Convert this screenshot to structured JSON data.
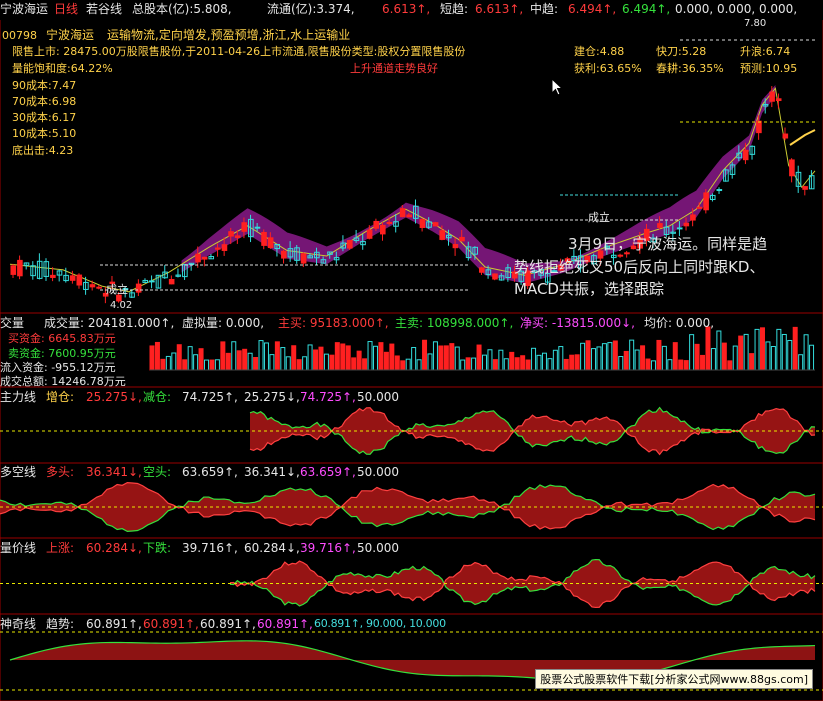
{
  "header": {
    "stock_name": "宁波海运",
    "period": "日线",
    "range": "若谷线",
    "total_equity_label": "总股本(亿):5.808,",
    "float_label": "流通(亿):3.374,",
    "float_val": "6.613↑,",
    "short_label": "短趋:",
    "short_val": "6.613↑,",
    "mid_label": "中趋:",
    "mid_val": "6.494↑,",
    "mid_val2": "6.494↑,",
    "zeros": "0.000, 0.000, 0.000,"
  },
  "info": {
    "code_line_code": "00798",
    "code_line_name": "宁波海运",
    "code_line_tags": "运输物流,定向增发,预盈预增,浙江,水上运输业",
    "restricted_line": "限售上市: 28475.00万股限售股份,于2011-04-26上市流通,限售股份类型:股权分置限售股份",
    "uptrend_note": "上升通道走势良好",
    "saturation": "量能饱和度:64.22%",
    "cost90": "90成本:7.47",
    "cost70": "70成本:6.98",
    "cost30": "30成本:6.17",
    "cost10": "10成本:5.10",
    "bottom": "底出击:4.23"
  },
  "right_panel": {
    "build": "建仓:4.88",
    "profit": "获利:63.65%",
    "fast": "快刀:5.28",
    "spring": "春耕:36.35%",
    "rise": "升浪:6.74",
    "forecast": "预测:10.95",
    "high_mark": "7.80"
  },
  "annotations": {
    "main_note": "3月9日，宁波海运。同样是趋势线拒绝死叉50后反向上同时跟KD、MACD共振，选择跟踪",
    "main_note_line1": "3月9日，宁波海运。同样是趋",
    "main_note_line2": "势线拒绝死叉50后反向上同时跟KD、",
    "main_note_line3": "MACD共振，选择跟踪",
    "chengli1": "成立",
    "chengli2": "成立",
    "low_mark": "4.02"
  },
  "volume_panel": {
    "label": "交量",
    "vol": "成交量: 204181.000↑,",
    "virtual": "虚拟量: 0.000,",
    "active_buy": "主买: 95183.000↑,",
    "active_sell": "主卖: 108998.000↑,",
    "net_buy": "净买: -13815.000↓,",
    "avg": "均价: 0.000,",
    "buy_funds": "买资金: 6645.83万元",
    "sell_funds": "卖资金: 7600.95万元",
    "in_funds": "流入资金: -955.12万元",
    "total": "成交总额: 14246.78万元"
  },
  "indicators": [
    {
      "name": "主力线",
      "a_label": "增仓:",
      "a": "25.275↓,",
      "b_label": "减仓:",
      "b": "74.725↑,",
      "c": "25.275↓,",
      "d": "74.725↑,",
      "e": "50.000"
    },
    {
      "name": "多空线",
      "a_label": "多头:",
      "a": "36.341↓,",
      "b_label": "空头:",
      "b": "63.659↑,",
      "c": "36.341↓,",
      "d": "63.659↑,",
      "e": "50.000"
    },
    {
      "name": "量价线",
      "a_label": "上涨:",
      "a": "60.284↓,",
      "b_label": "下跌:",
      "b": "39.716↑,",
      "c": "60.284↓,",
      "d": "39.716↑,",
      "e": "50.000"
    },
    {
      "name": "神奇线",
      "a_label": "趋势:",
      "a": "60.891↑,",
      "b_label": "",
      "b": "60.891↑,",
      "c": "60.891↑,",
      "d": "60.891↑,",
      "e": "60.891↑, 90.000, 10.000"
    }
  ],
  "footer": "股票公式股票软件下载[分析家公式网www.88gs.com]",
  "colors": {
    "up": "#ff2020",
    "down": "#33dddd",
    "purple": "#8a1a8a",
    "green": "#35e03c",
    "yellow": "#ffd24a",
    "dash_white": "#dddddd",
    "dash_yellow": "#e8e800"
  }
}
